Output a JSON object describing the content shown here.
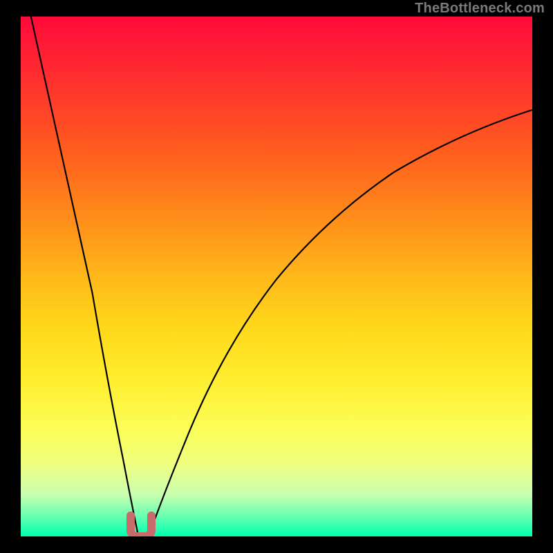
{
  "watermark": {
    "text": "TheBottleneck.com"
  },
  "colors": {
    "curve": "#000000",
    "valley_marker": "#c96b6b",
    "background_black": "#000000"
  },
  "chart_data": {
    "type": "line",
    "title": "",
    "xlabel": "",
    "ylabel": "",
    "xlim": [
      0,
      100
    ],
    "ylim": [
      0,
      100
    ],
    "legend": false,
    "grid": false,
    "background": "rainbow-vertical-gradient (red→yellow→green)",
    "series": [
      {
        "name": "left-branch",
        "x": [
          2,
          4,
          6,
          8,
          10,
          12,
          14,
          16,
          18,
          20,
          21,
          22,
          23
        ],
        "y": [
          100,
          93,
          84,
          74,
          63,
          51,
          39,
          27,
          16,
          7,
          3.5,
          1.2,
          0
        ]
      },
      {
        "name": "right-branch",
        "x": [
          25,
          26,
          28,
          30,
          33,
          36,
          40,
          45,
          50,
          55,
          60,
          66,
          72,
          80,
          88,
          95,
          100
        ],
        "y": [
          0,
          1.2,
          5,
          10,
          17,
          24,
          32,
          40,
          47,
          53,
          58,
          63,
          67,
          72,
          76,
          79,
          82
        ]
      }
    ],
    "annotations": [
      {
        "name": "valley-marker",
        "shape": "u-mark",
        "x_range": [
          21.5,
          25.5
        ],
        "y_range": [
          0,
          3
        ],
        "color": "#c96b6b"
      }
    ]
  }
}
